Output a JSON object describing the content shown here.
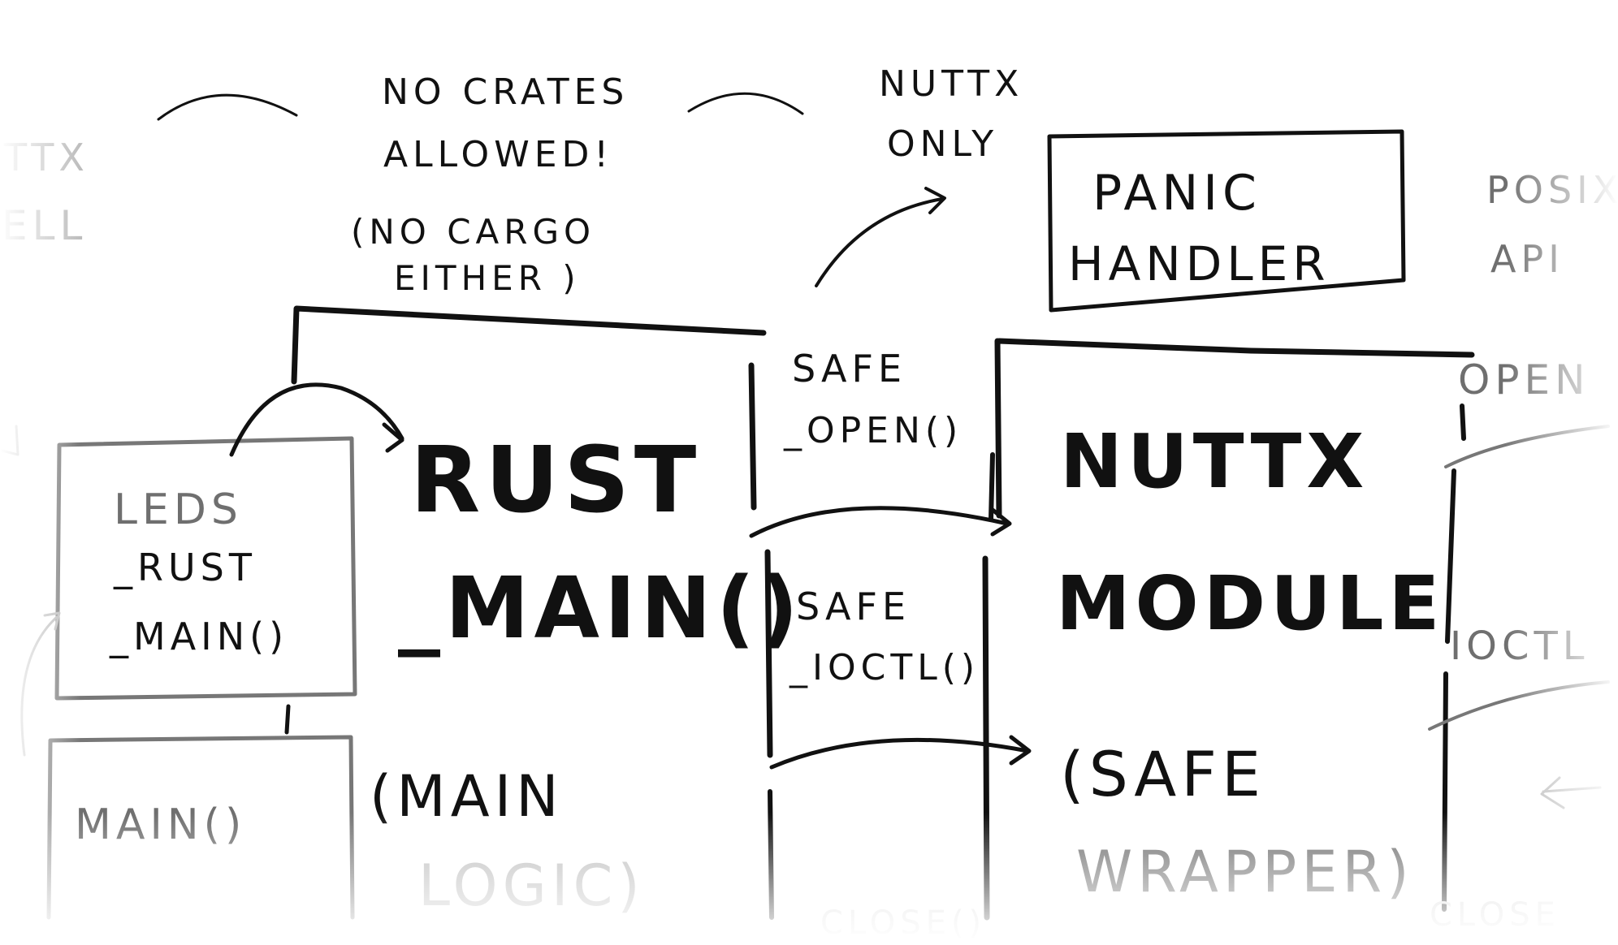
{
  "notes": {
    "no_crates_line1": "NO CRATES",
    "no_crates_line2": "ALLOWED!",
    "no_cargo_line1": "(NO CARGO",
    "no_cargo_line2": "EITHER )",
    "nuttx_only_line1": "NUTTX",
    "nuttx_only_line2": "ONLY"
  },
  "boxes": {
    "panic_handler_line1": "PANIC",
    "panic_handler_line2": "HANDLER",
    "leds_rust_main_line1": "LEDS",
    "leds_rust_main_line2": "_RUST",
    "leds_rust_main_line3": "_MAIN()",
    "main": "MAIN()",
    "rust_main_line1": "RUST",
    "rust_main_line2": "_MAIN()",
    "main_logic_line1": "(MAIN",
    "main_logic_line2": "LOGIC)",
    "nuttx_module_line1": "NUTTX",
    "nuttx_module_line2": "MODULE",
    "safe_wrapper_line1": "(SAFE",
    "safe_wrapper_line2": "WRAPPER)"
  },
  "calls": {
    "safe_open_line1": "SAFE",
    "safe_open_line2": "_OPEN()",
    "safe_ioctl_line1": "SAFE",
    "safe_ioctl_line2": "_IOCTL()"
  },
  "edges": {
    "left_top_line1": "TTX",
    "left_top_line2": "ELL",
    "posix_line1": "POSIX",
    "posix_line2": "API",
    "open": "OPEN",
    "ioctl": "IOCTL",
    "close_left": "CLOSE()",
    "close_right": "CLOSE"
  },
  "colors": {
    "ink": "#111111",
    "faded": "#6f6f6f",
    "ghost": "#bdbdbd"
  }
}
